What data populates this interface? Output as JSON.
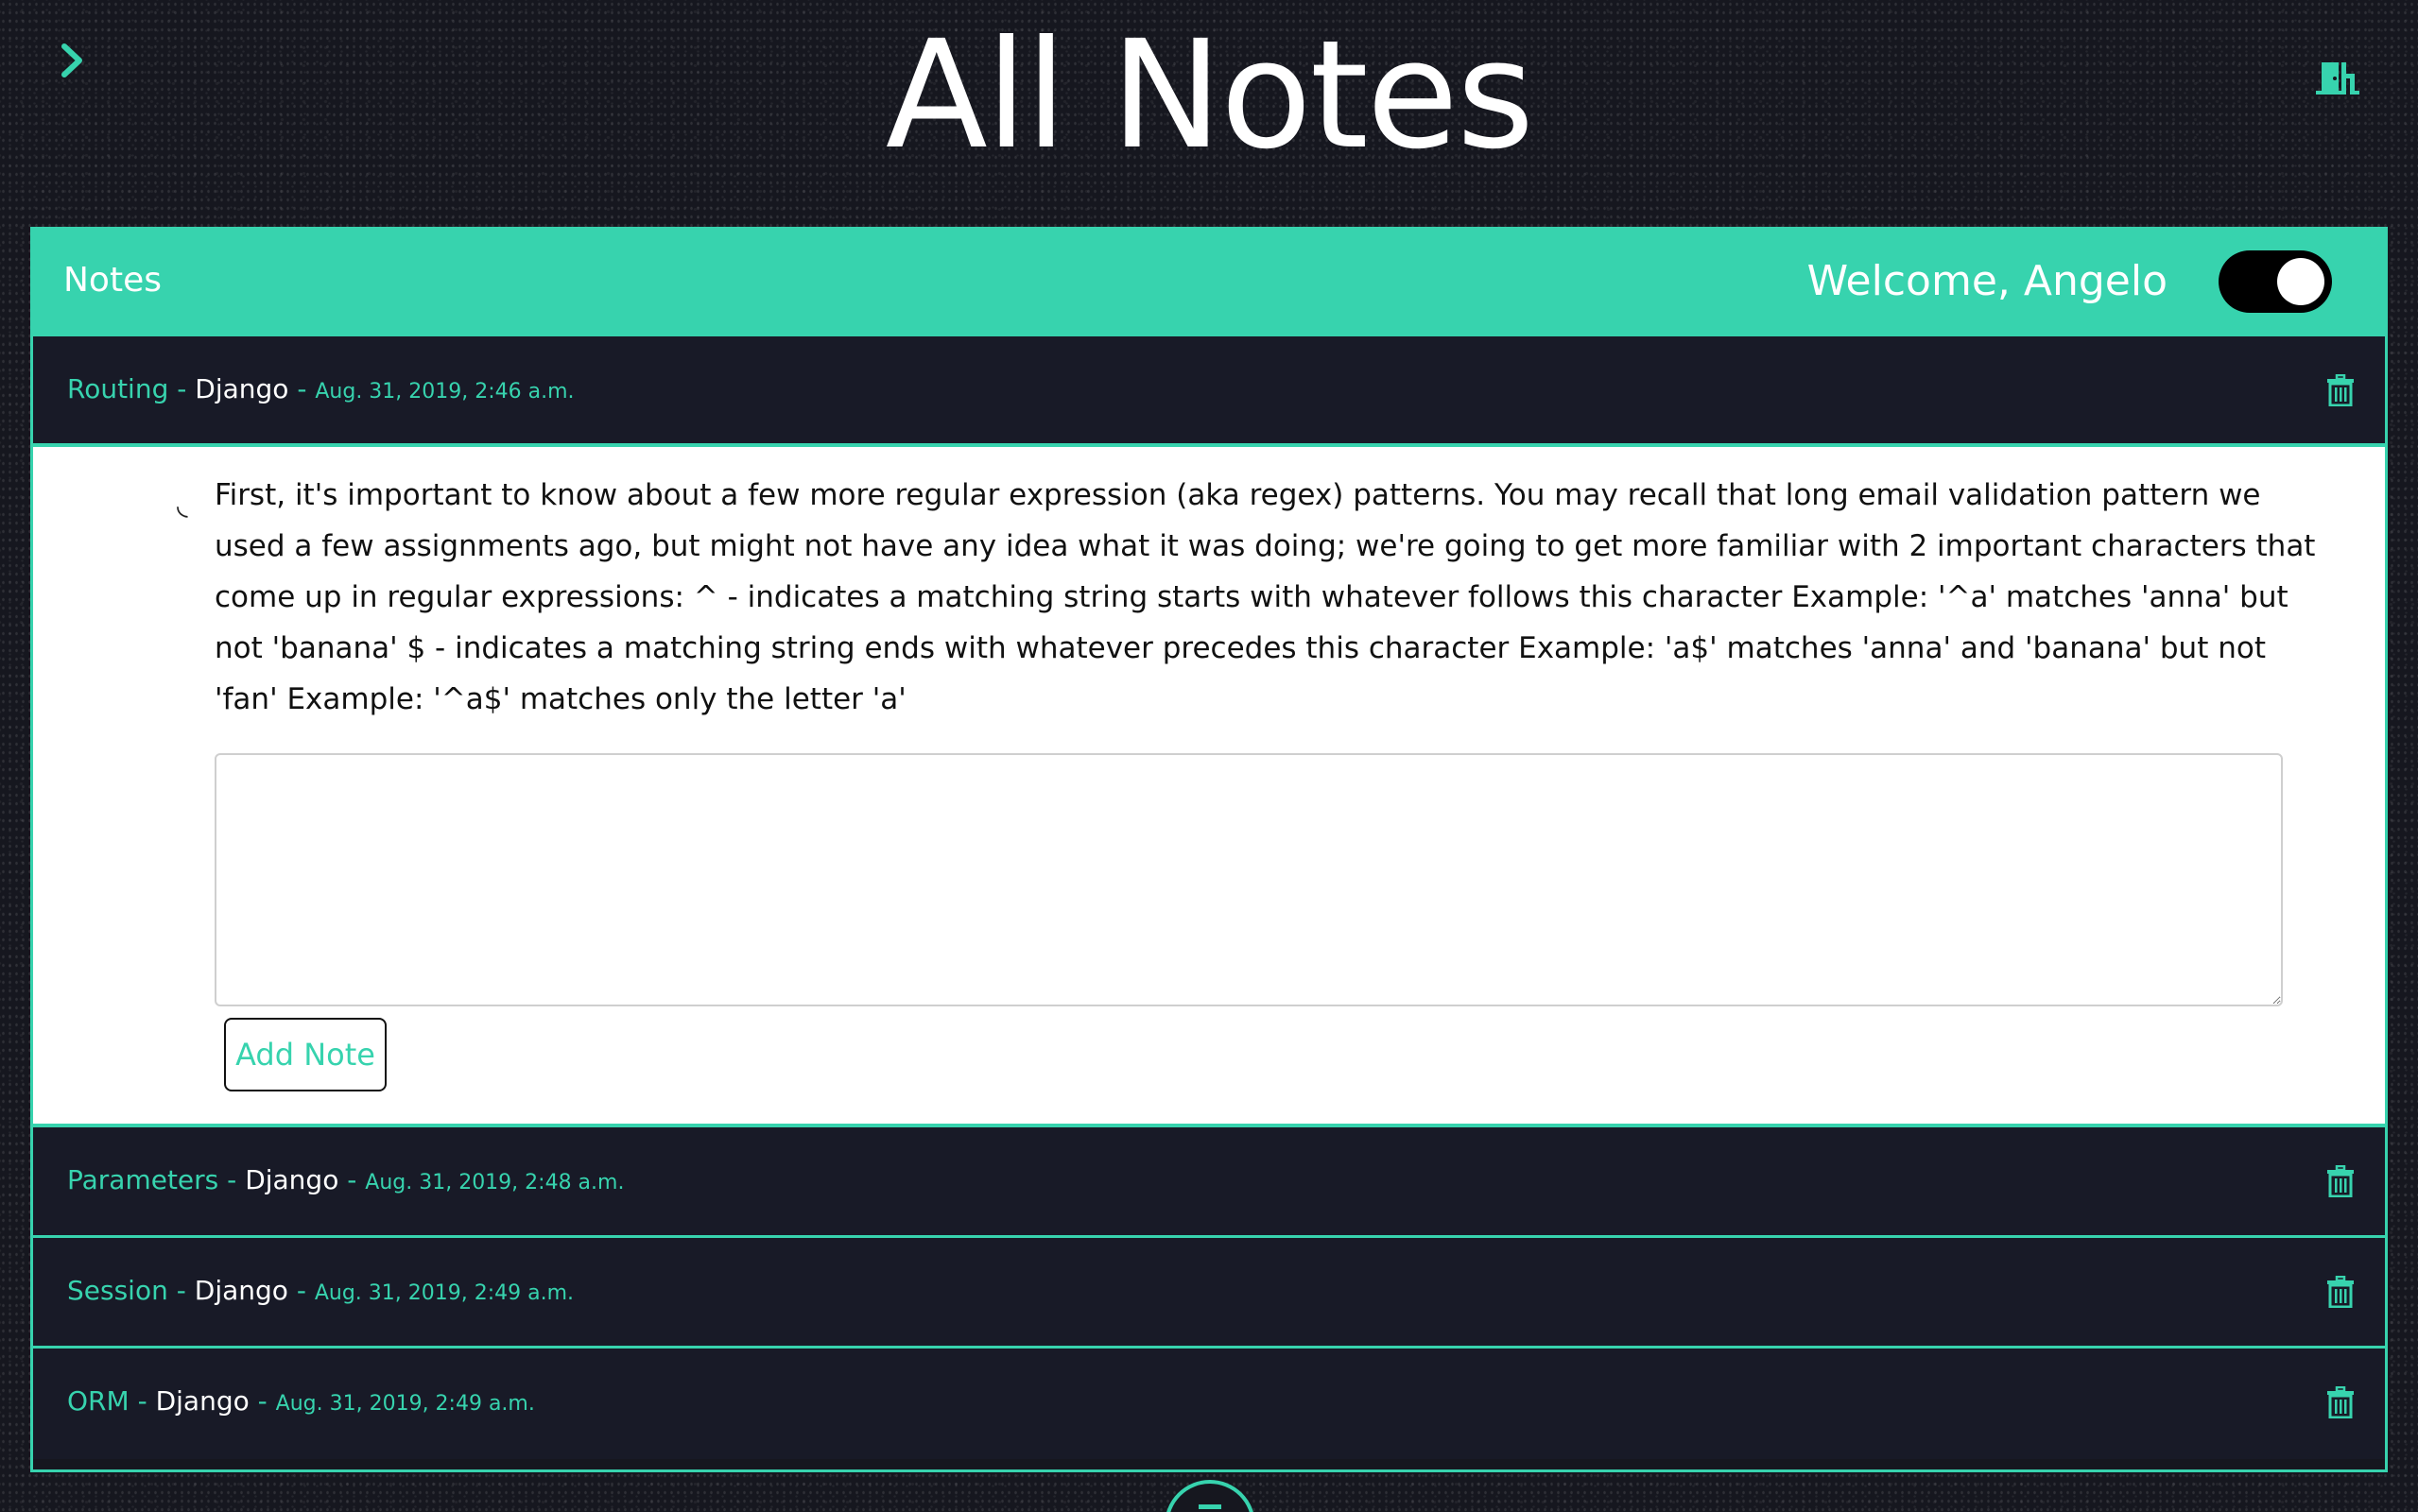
{
  "header": {
    "title": "All Notes",
    "menu_icon": "chevron-right-icon",
    "logout_icon": "door-exit-icon"
  },
  "panel": {
    "title": "Notes",
    "welcome": "Welcome, Angelo",
    "theme_toggle_on": true
  },
  "colors": {
    "accent": "#37d3ae",
    "background": "#16171f",
    "row_background": "#181a27"
  },
  "notes": [
    {
      "title": "Routing",
      "separator": "-",
      "category": "Django",
      "date": "Aug. 31, 2019, 2:46 a.m.",
      "expanded": true,
      "content": "First, it's important to know about a few more regular expression (aka regex) patterns. You may recall that long email validation pattern we used a few assignments ago, but might not have any idea what it was doing; we're going to get more familiar with 2 important characters that come up in regular expressions: ^ - indicates a matching string starts with whatever follows this character Example: '^a' matches 'anna' but not 'banana' $ - indicates a matching string ends with whatever precedes this character Example: 'a$' matches 'anna' and 'banana' but not 'fan' Example: '^a$' matches only the letter 'a'"
    },
    {
      "title": "Parameters",
      "separator": "-",
      "category": "Django",
      "date": "Aug. 31, 2019, 2:48 a.m."
    },
    {
      "title": "Session",
      "separator": "-",
      "category": "Django",
      "date": "Aug. 31, 2019, 2:49 a.m."
    },
    {
      "title": "ORM",
      "separator": "-",
      "category": "Django",
      "date": "Aug. 31, 2019, 2:49 a.m."
    }
  ],
  "add_note": {
    "button_label": "Add Note",
    "textarea_value": ""
  }
}
